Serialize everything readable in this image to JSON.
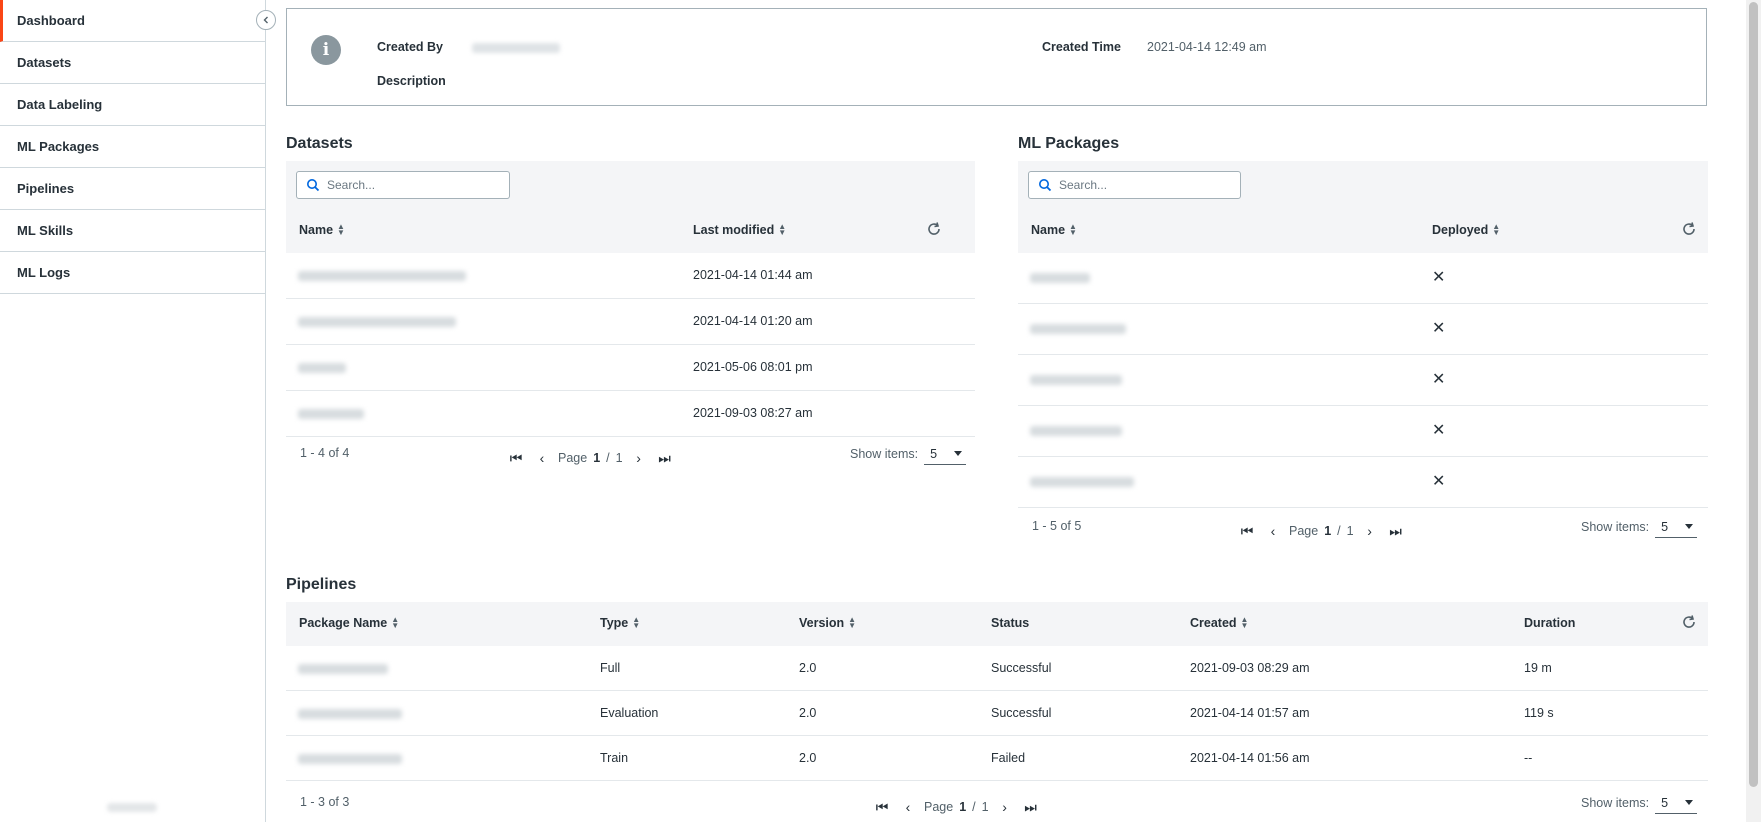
{
  "sidebar": {
    "items": [
      {
        "label": "Dashboard"
      },
      {
        "label": "Datasets"
      },
      {
        "label": "Data Labeling"
      },
      {
        "label": "ML Packages"
      },
      {
        "label": "Pipelines"
      },
      {
        "label": "ML Skills"
      },
      {
        "label": "ML Logs"
      }
    ],
    "active_index": 0
  },
  "info": {
    "created_by_label": "Created By",
    "description_label": "Description",
    "created_time_label": "Created Time",
    "created_time_value": "2021-04-14 12:49 am",
    "icon": "info-icon"
  },
  "datasets": {
    "title": "Datasets",
    "search_placeholder": "Search...",
    "columns": {
      "name": "Name",
      "last_modified": "Last modified"
    },
    "rows": [
      {
        "last_modified": "2021-04-14 01:44 am"
      },
      {
        "last_modified": "2021-04-14 01:20 am"
      },
      {
        "last_modified": "2021-05-06 08:01 pm"
      },
      {
        "last_modified": "2021-09-03 08:27 am"
      }
    ],
    "count_text": "1 - 4 of 4",
    "page_label": "Page",
    "page": "1",
    "sep": "/",
    "total_pages": "1",
    "show_items_label": "Show items:",
    "show_items_value": "5"
  },
  "ml_packages": {
    "title": "ML Packages",
    "search_placeholder": "Search...",
    "columns": {
      "name": "Name",
      "deployed": "Deployed"
    },
    "rows": [
      {
        "deployed": "✕"
      },
      {
        "deployed": "✕"
      },
      {
        "deployed": "✕"
      },
      {
        "deployed": "✕"
      },
      {
        "deployed": "✕"
      }
    ],
    "count_text": "1 - 5 of 5",
    "page_label": "Page",
    "page": "1",
    "sep": "/",
    "total_pages": "1",
    "show_items_label": "Show items:",
    "show_items_value": "5"
  },
  "pipelines": {
    "title": "Pipelines",
    "columns": {
      "package_name": "Package Name",
      "type": "Type",
      "version": "Version",
      "status": "Status",
      "created": "Created",
      "duration": "Duration"
    },
    "rows": [
      {
        "type": "Full",
        "version": "2.0",
        "status": "Successful",
        "created": "2021-09-03 08:29 am",
        "duration": "19 m"
      },
      {
        "type": "Evaluation",
        "version": "2.0",
        "status": "Successful",
        "created": "2021-04-14 01:57 am",
        "duration": "119 s"
      },
      {
        "type": "Train",
        "version": "2.0",
        "status": "Failed",
        "created": "2021-04-14 01:56 am",
        "duration": "--"
      }
    ],
    "count_text": "1 - 3 of 3",
    "page_label": "Page",
    "page": "1",
    "sep": "/",
    "total_pages": "1",
    "show_items_label": "Show items:",
    "show_items_value": "5"
  },
  "colors": {
    "accent": "#fa4616",
    "header_bg": "#f4f5f7",
    "border": "#cfd8dd"
  }
}
